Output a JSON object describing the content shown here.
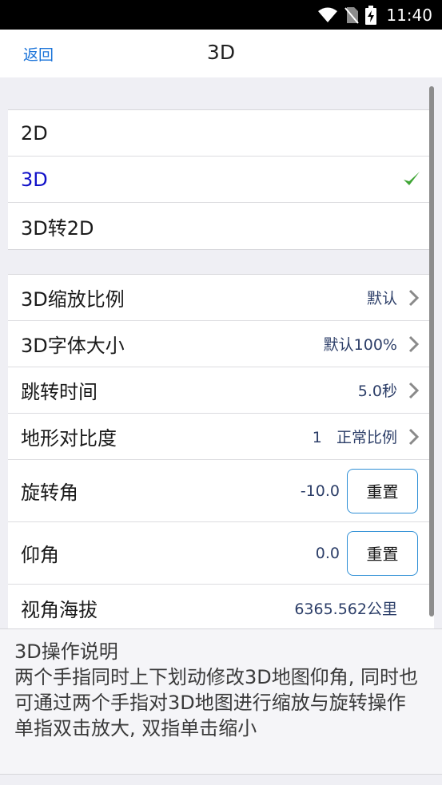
{
  "status": {
    "time": "11:40"
  },
  "nav": {
    "back_label": "返回",
    "title": "3D"
  },
  "mode_options": [
    {
      "label": "2D",
      "selected": false
    },
    {
      "label": "3D",
      "selected": true
    },
    {
      "label": "3D转2D",
      "selected": false
    }
  ],
  "settings": {
    "zoom_scale": {
      "label": "3D缩放比例",
      "value": "默认"
    },
    "font_size": {
      "label": "3D字体大小",
      "value": "默认100%"
    },
    "jump_time": {
      "label": "跳转时间",
      "value": "5.0秒"
    },
    "terrain_contrast": {
      "label": "地形对比度",
      "value": "1   正常比例"
    },
    "rotation": {
      "label": "旋转角",
      "value": "-10.0",
      "button": "重置"
    },
    "pitch": {
      "label": "仰角",
      "value": "0.0",
      "button": "重置"
    },
    "altitude": {
      "label": "视角海拔",
      "value": "6365.562公里"
    }
  },
  "description": {
    "title": "3D操作说明",
    "line1": "两个手指同时上下划动修改3D地图仰角, 同时也可通过两个手指对3D地图进行缩放与旋转操作",
    "line2": "单指双击放大, 双指单击缩小"
  },
  "colors": {
    "accent": "#1a73d9",
    "selected": "#1010c8",
    "check": "#3fa535"
  }
}
